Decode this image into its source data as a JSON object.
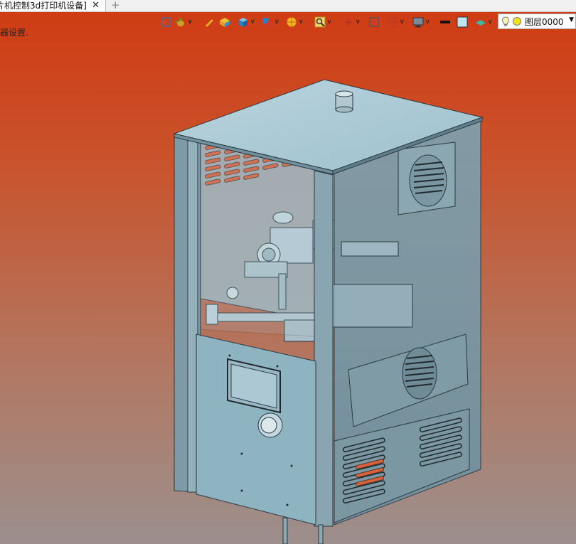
{
  "tab": {
    "title": "片机控制3d打印机设备]",
    "close_glyph": "✕",
    "add_glyph": "+"
  },
  "toolbar": {
    "layer_name": "图层0000",
    "tools": [
      {
        "name": "exit-icon"
      },
      {
        "name": "teapot-icon"
      },
      {
        "name": "pen-icon"
      },
      {
        "name": "box-icon"
      },
      {
        "name": "cube-icon"
      },
      {
        "name": "cube-group-icon"
      },
      {
        "name": "sphere-icon"
      },
      {
        "name": "zoom-icon"
      },
      {
        "name": "rotate-icon"
      },
      {
        "name": "frame-icon"
      },
      {
        "name": "split-icon"
      },
      {
        "name": "monitor-icon"
      },
      {
        "name": "black-line-icon"
      },
      {
        "name": "color-swatch-icon"
      },
      {
        "name": "plane-icon"
      }
    ]
  },
  "status": {
    "text": "器设置."
  },
  "colors": {
    "background_top": "#d03a12",
    "background_bottom": "#9c8f8d",
    "model_body": "#8fb4c1",
    "model_edge": "#2a3a40",
    "vent_orange": "#d9603a"
  }
}
